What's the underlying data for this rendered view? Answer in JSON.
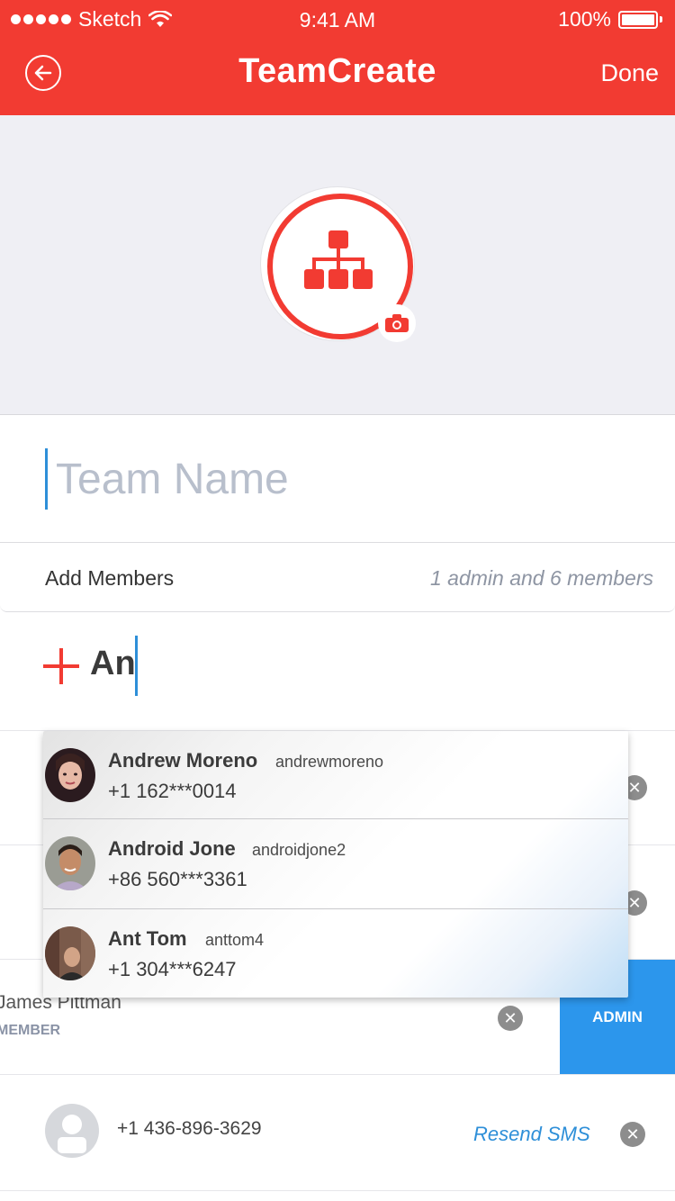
{
  "status_bar": {
    "carrier": "Sketch",
    "time": "9:41 AM",
    "battery": "100%"
  },
  "nav": {
    "title": "TeamCreate",
    "done_label": "Done"
  },
  "team_name": {
    "placeholder": "Team Name",
    "value": ""
  },
  "members": {
    "label": "Add Members",
    "count": "1 admin and 6 members"
  },
  "search": {
    "query": "An"
  },
  "suggestions": [
    {
      "name": "Andrew Moreno",
      "username": "andrewmoreno",
      "phone": "+1 162***0014"
    },
    {
      "name": "Android Jone",
      "username": "androidjone2",
      "phone": "+86 560***3361"
    },
    {
      "name": "Ant Tom",
      "username": "anttom4",
      "phone": "+1 304***6247"
    }
  ],
  "member_list": {
    "james": {
      "name": "James Pittman",
      "role": "MEMBER",
      "admin_label": "ADMIN"
    },
    "pending": {
      "phone": "+1 436-896-3629",
      "resend_label": "Resend SMS"
    }
  },
  "colors": {
    "brand": "#f23b32",
    "accent": "#2e8fd8",
    "admin": "#2c96ec"
  }
}
